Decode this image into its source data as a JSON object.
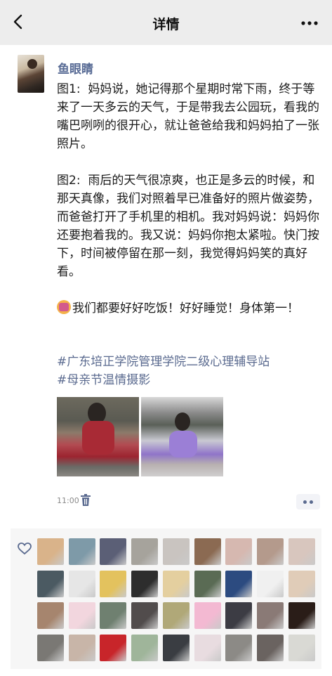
{
  "header": {
    "title": "详情"
  },
  "post": {
    "author": "鱼眼睛",
    "paragraphs": [
      "图1:  妈妈说，她记得那个星期时常下雨，终于等来了一天多云的天气，于是带我去公园玩，看我的嘴巴咧咧的很开心，就让爸爸给我和妈妈拍了一张照片。",
      "图2:  雨后的天气很凉爽，也正是多云的时候，和那天真像，我们对照着早已准备好的照片做姿势，而爸爸打开了手机里的相机。我对妈妈说：妈妈你还要抱着我的。我又说：妈妈你抱太紧啦。快门按下，时间被停留在那一刻，我觉得妈妈笑的真好看。",
      "我们都要好好吃饭！好好睡觉！身体第一！"
    ],
    "hashtags": [
      "#广东培正学院管理学院二级心理辅导站",
      "#母亲节温情摄影"
    ],
    "time": "11:00"
  },
  "likes": {
    "avatar_colors": [
      "#d9b38a",
      "#7e9aa8",
      "#5b5f76",
      "#a6a39c",
      "#c9c4c0",
      "#8b6a52",
      "#d6b8b0",
      "#b49a8c",
      "#d8c6be",
      "#4b5a62",
      "#e6e6e6",
      "#e3c25e",
      "#2d2d2d",
      "#e4cf9f",
      "#5a6b54",
      "#2c4b80",
      "#f0f0f0",
      "#e0ccb8",
      "#a6856e",
      "#f2d6de",
      "#6f8070",
      "#514c4c",
      "#b0a878",
      "#f3b9d2",
      "#3c3c44",
      "#8a7a76",
      "#2a1d18",
      "#7a7874",
      "#c8b5a8",
      "#c8252a",
      "#9fb59a",
      "#3a3d42",
      "#e8dce0",
      "#8c8a86",
      "#6a6360",
      "#d9d9d4"
    ]
  }
}
